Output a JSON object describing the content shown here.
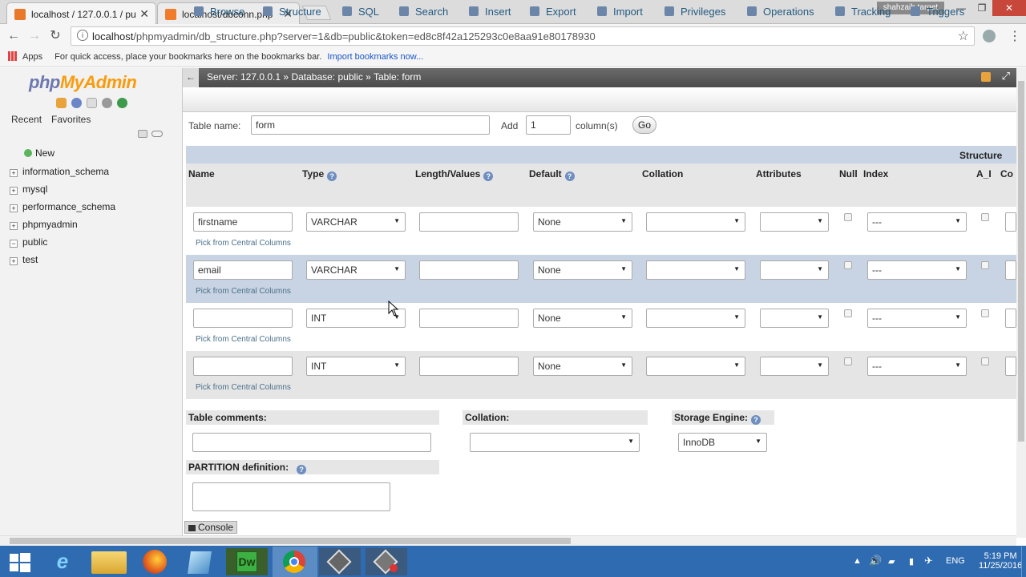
{
  "browser": {
    "tabs": [
      {
        "title": "localhost / 127.0.0.1 / pu"
      },
      {
        "title": "localhost/dbconn.php"
      }
    ],
    "user": "shahzaib target",
    "url_host": "localhost",
    "url_rest": "/phpmyadmin/db_structure.php?server=1&db=public&token=ed8c8f42a125293c0e8aa91e80178930",
    "bookmarks_apps": "Apps",
    "bookmarks_hint": "For quick access, place your bookmarks here on the bookmarks bar.",
    "bookmarks_link": "Import bookmarks now..."
  },
  "sidebar": {
    "logo_php": "php",
    "logo_myadmin": "MyAdmin",
    "tabs": [
      "Recent",
      "Favorites"
    ],
    "tree": [
      {
        "label": "New",
        "toggle": ""
      },
      {
        "label": "information_schema",
        "toggle": "+"
      },
      {
        "label": "mysql",
        "toggle": "+"
      },
      {
        "label": "performance_schema",
        "toggle": "+"
      },
      {
        "label": "phpmyadmin",
        "toggle": "+"
      },
      {
        "label": "public",
        "toggle": "−"
      },
      {
        "label": "test",
        "toggle": "+"
      }
    ]
  },
  "breadcrumb": {
    "server": "Server: 127.0.0.1",
    "sep": "»",
    "database": "Database: public",
    "table": "Table: form"
  },
  "menu": [
    "Browse",
    "Structure",
    "SQL",
    "Search",
    "Insert",
    "Export",
    "Import",
    "Privileges",
    "Operations",
    "Tracking",
    "Triggers"
  ],
  "form": {
    "table_name_label": "Table name:",
    "table_name": "form",
    "add_label": "Add",
    "add_value": "1",
    "columns_label": "column(s)",
    "go": "Go",
    "structure_label": "Structure",
    "headers": {
      "name": "Name",
      "type": "Type",
      "length": "Length/Values",
      "default": "Default",
      "collation": "Collation",
      "attributes": "Attributes",
      "null": "Null",
      "index": "Index",
      "ai": "A_I",
      "co": "Co"
    },
    "rows": [
      {
        "name": "firstname",
        "type": "VARCHAR",
        "length": "",
        "default": "None",
        "collation": "",
        "attributes": "",
        "index": "---",
        "pick": "Pick from Central Columns"
      },
      {
        "name": "email",
        "type": "VARCHAR",
        "length": "",
        "default": "None",
        "collation": "",
        "attributes": "",
        "index": "---",
        "pick": "Pick from Central Columns"
      },
      {
        "name": "",
        "type": "INT",
        "length": "",
        "default": "None",
        "collation": "",
        "attributes": "",
        "index": "---",
        "pick": "Pick from Central Columns"
      },
      {
        "name": "",
        "type": "INT",
        "length": "",
        "default": "None",
        "collation": "",
        "attributes": "",
        "index": "---",
        "pick": "Pick from Central Columns"
      }
    ],
    "table_comments_label": "Table comments:",
    "collation_label": "Collation:",
    "storage_engine_label": "Storage Engine:",
    "storage_engine": "InnoDB",
    "partition_label": "PARTITION definition:",
    "console": "Console"
  },
  "taskbar": {
    "lang": "ENG",
    "time": "5:19 PM",
    "date": "11/25/2016"
  },
  "colors": {
    "pma_blue": "#235a81",
    "taskbar": "#2f6bb0",
    "row_alt": "#e5e5e5",
    "row_highlight": "#c8d4e3"
  }
}
